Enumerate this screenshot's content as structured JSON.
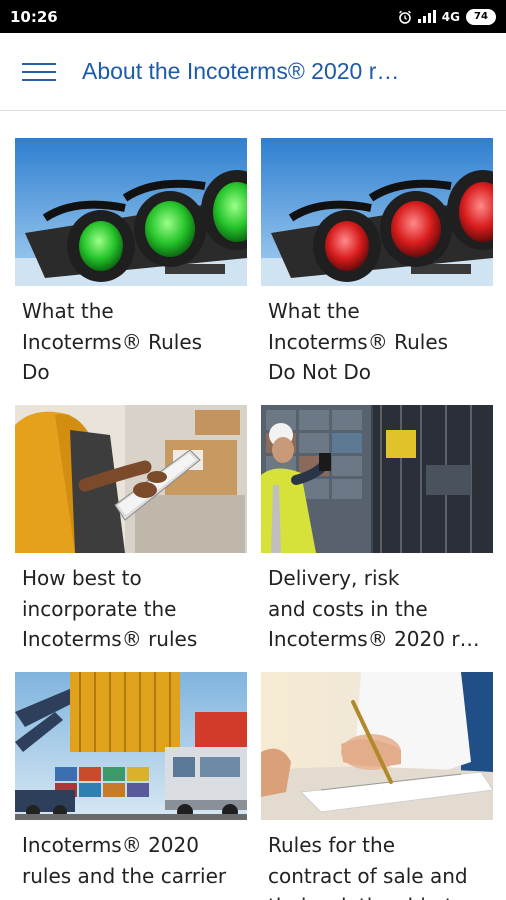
{
  "status_bar": {
    "time": "10:26",
    "network": "4G",
    "battery": "74",
    "icons": [
      "alarm-icon",
      "signal-icon",
      "battery-icon"
    ]
  },
  "app_bar": {
    "title": "About the Incoterms® 2020 r…",
    "menu_icon": "hamburger-menu-icon",
    "title_color": "#1d5aa8"
  },
  "cards": [
    {
      "title": "What the\nIncoterms® Rules\nDo",
      "image": "green-traffic-lights"
    },
    {
      "title": "What the\nIncoterms® Rules\nDo Not Do",
      "image": "red-traffic-lights"
    },
    {
      "title": "How best to\nincorporate the\nIncoterms® rules",
      "image": "person-with-tablet-in-warehouse"
    },
    {
      "title": "Delivery, risk\nand costs in the\nIncoterms® 2020 r…",
      "image": "worker-at-container-port"
    },
    {
      "title": "Incoterms® 2020\nrules and the carrier",
      "image": "container-crane-and-truck"
    },
    {
      "title": "Rules for the\ncontract of sale and\ntheir relationship t…",
      "image": "hand-signing-document"
    }
  ]
}
